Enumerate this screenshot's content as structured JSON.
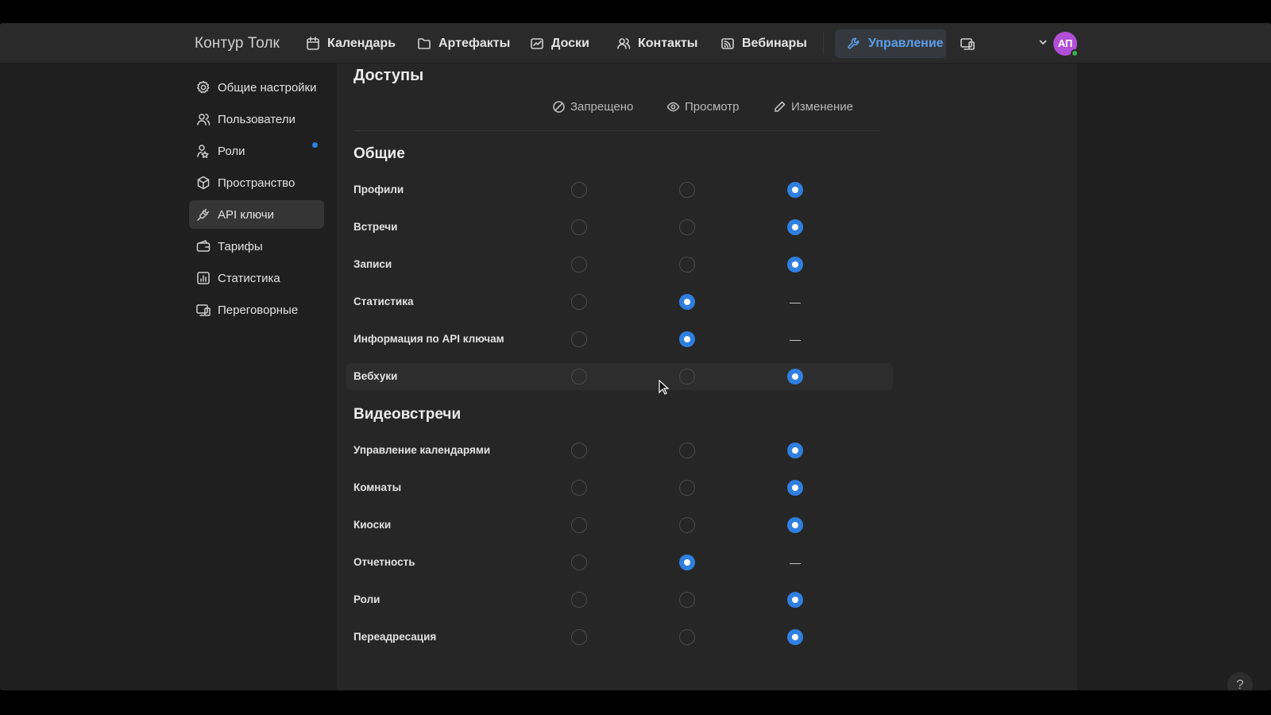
{
  "header": {
    "brand": "Контур Толк",
    "nav": [
      {
        "label": "Календарь",
        "icon": "calendar-icon"
      },
      {
        "label": "Артефакты",
        "icon": "folder-icon"
      },
      {
        "label": "Доски",
        "icon": "board-icon"
      },
      {
        "label": "Контакты",
        "icon": "contacts-icon"
      },
      {
        "label": "Вебинары",
        "icon": "broadcast-icon"
      },
      {
        "label": "Управление",
        "icon": "wrench-icon",
        "active": true
      }
    ],
    "devices_icon": "devices-icon",
    "avatar_initials": "АП",
    "avatar_color": "#b14fd6",
    "status_color": "#37b24d"
  },
  "sidebar": {
    "items": [
      {
        "label": "Общие настройки",
        "icon": "gear-icon"
      },
      {
        "label": "Пользователи",
        "icon": "users-icon",
        "badge": true
      },
      {
        "label": "Роли",
        "icon": "roles-icon"
      },
      {
        "label": "Пространство",
        "icon": "cube-icon"
      },
      {
        "label": "API ключи",
        "icon": "plug-icon",
        "active": true
      },
      {
        "label": "Тарифы",
        "icon": "wallet-icon"
      },
      {
        "label": "Статистика",
        "icon": "chart-icon"
      },
      {
        "label": "Переговорные",
        "icon": "meeting-room-icon"
      }
    ]
  },
  "main": {
    "title": "Доступы",
    "columns": [
      {
        "label": "Запрещено",
        "icon": "forbidden-icon"
      },
      {
        "label": "Просмотр",
        "icon": "eye-icon"
      },
      {
        "label": "Изменение",
        "icon": "pencil-icon"
      }
    ],
    "sections": [
      {
        "title": "Общие",
        "rows": [
          {
            "label": "Профили",
            "value": "edit"
          },
          {
            "label": "Встречи",
            "value": "edit"
          },
          {
            "label": "Записи",
            "value": "edit"
          },
          {
            "label": "Статистика",
            "value": "view",
            "edit_disabled": true
          },
          {
            "label": "Информация по API ключам",
            "value": "view",
            "edit_disabled": true
          },
          {
            "label": "Вебхуки",
            "value": "edit",
            "hovered": true
          }
        ]
      },
      {
        "title": "Видеовстречи",
        "rows": [
          {
            "label": "Управление календарями",
            "value": "edit"
          },
          {
            "label": "Комнаты",
            "value": "edit"
          },
          {
            "label": "Киоски",
            "value": "edit"
          },
          {
            "label": "Отчетность",
            "value": "view",
            "edit_disabled": true
          },
          {
            "label": "Роли",
            "value": "edit"
          },
          {
            "label": "Переадресация",
            "value": "edit"
          }
        ]
      }
    ],
    "disabled_mark": "—",
    "accent_color": "#2f7fe0"
  },
  "help_label": "?"
}
